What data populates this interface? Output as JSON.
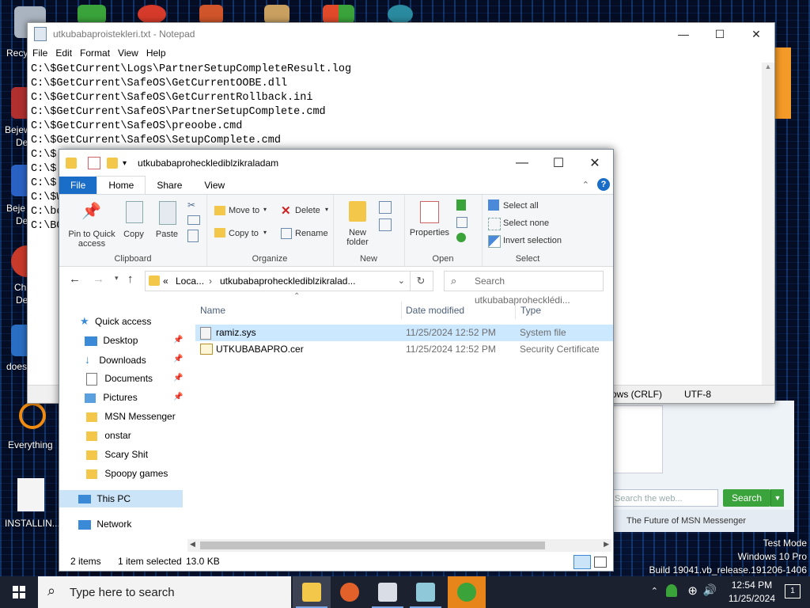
{
  "desktop": {
    "labels": [
      "Recy",
      "Bejew",
      "De",
      "Beje",
      "De",
      "Ch",
      "De",
      "does",
      "Everything",
      "INSTALLIN..."
    ]
  },
  "notepad": {
    "title": "utkubabaproistekleri.txt - Notepad",
    "menu": [
      "File",
      "Edit",
      "Format",
      "View",
      "Help"
    ],
    "lines": [
      "C:\\$GetCurrent\\Logs\\PartnerSetupCompleteResult.log",
      "C:\\$GetCurrent\\SafeOS\\GetCurrentOOBE.dll",
      "C:\\$GetCurrent\\SafeOS\\GetCurrentRollback.ini",
      "C:\\$GetCurrent\\SafeOS\\PartnerSetupComplete.cmd",
      "C:\\$GetCurrent\\SafeOS\\preoobe.cmd",
      "C:\\$GetCurrent\\SafeOS\\SetupComplete.cmd",
      "C:\\$",
      "C:\\$",
      "C:\\$",
      "C:\\$W",
      "C:\\bo",
      "C:\\BO"
    ],
    "status_eol": "ows (CRLF)",
    "status_encoding": "UTF-8"
  },
  "msn": {
    "search_placeholder": "Search the web...",
    "search_button": "Search",
    "footer": "The Future of MSN Messenger"
  },
  "explorer": {
    "title": "utkubabaprohecklediblzikraladam",
    "tabs": [
      "File",
      "Home",
      "Share",
      "View"
    ],
    "ribbon": {
      "clipboard": {
        "label": "Clipboard",
        "pin": "Pin to Quick access",
        "copy": "Copy",
        "paste": "Paste"
      },
      "organize": {
        "label": "Organize",
        "move_to": "Move to",
        "copy_to": "Copy to",
        "delete": "Delete",
        "rename": "Rename"
      },
      "new": {
        "label": "New",
        "new_folder": "New folder"
      },
      "open": {
        "label": "Open",
        "properties": "Properties"
      },
      "select": {
        "label": "Select",
        "select_all": "Select all",
        "select_none": "Select none",
        "invert": "Invert selection"
      }
    },
    "address": {
      "prefix": "«",
      "loc": "Loca...",
      "path": "utkubabaprohecklediblzikralad..."
    },
    "search_placeholder": "Search utkubabaprohecklédi...",
    "nav": {
      "quick_access": "Quick access",
      "items": [
        "Desktop",
        "Downloads",
        "Documents",
        "Pictures",
        "MSN Messenger",
        "onstar",
        "Scary Shit",
        "Spoopy games"
      ],
      "this_pc": "This PC",
      "network": "Network"
    },
    "columns": {
      "name": "Name",
      "date": "Date modified",
      "type": "Type"
    },
    "files": [
      {
        "name": "ramiz.sys",
        "date": "11/25/2024 12:52 PM",
        "type": "System file"
      },
      {
        "name": "UTKUBABAPRO.cer",
        "date": "11/25/2024 12:52 PM",
        "type": "Security Certificate"
      }
    ],
    "status": {
      "count": "2 items",
      "selected": "1 item selected",
      "size": "13.0 KB"
    }
  },
  "watermark": {
    "mode": "Test Mode",
    "edition": "Windows 10 Pro",
    "build": "Build 19041.vb_release.191206-1406"
  },
  "taskbar": {
    "search_placeholder": "Type here to search",
    "time": "12:54 PM",
    "date": "11/25/2024",
    "notif_count": "1"
  }
}
